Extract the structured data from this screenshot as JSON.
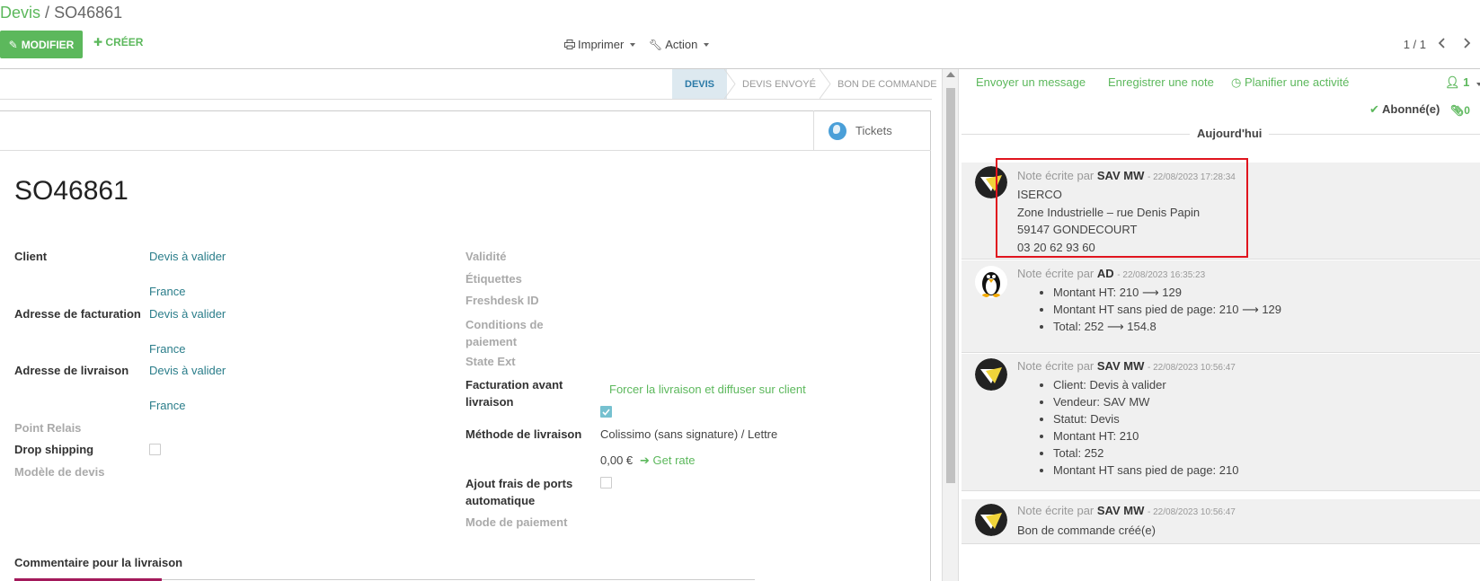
{
  "header": {
    "breadcrumb_parent": "Devis",
    "breadcrumb_sep": "/",
    "breadcrumb_current": "SO46861",
    "edit_button": "MODIFIER",
    "create_button": "CRÉER",
    "print_menu": "Imprimer",
    "action_menu": "Action",
    "pager": "1 / 1"
  },
  "statusbar": {
    "stages": [
      "DEVIS",
      "DEVIS ENVOYÉ",
      "BON DE COMMANDE"
    ],
    "active": "DEVIS"
  },
  "sheet": {
    "tickets_button": "Tickets",
    "order_name": "SO46861",
    "left": {
      "client_label": "Client",
      "client_value": "Devis à valider",
      "client_country": "France",
      "invoice_label": "Adresse de facturation",
      "invoice_value": "Devis à valider",
      "invoice_country": "France",
      "delivery_label": "Adresse de livraison",
      "delivery_value": "Devis à valider",
      "delivery_country": "France",
      "relay_label": "Point Relais",
      "dropship_label": "Drop shipping",
      "template_label": "Modèle de devis",
      "comment_label": "Commentaire pour la livraison"
    },
    "right": {
      "validity_label": "Validité",
      "tags_label": "Étiquettes",
      "freshdesk_label": "Freshdesk ID",
      "payment_terms_label": "Conditions de paiement",
      "state_ext_label": "State Ext",
      "invoice_before_label": "Facturation avant livraison",
      "force_delivery_button": "Forcer la livraison et diffuser sur client",
      "delivery_method_label": "Méthode de livraison",
      "delivery_method_value": "Colissimo (sans signature) / Lettre",
      "shipping_cost": "0,00 €",
      "get_rate_button": "Get rate",
      "auto_shipping_label": "Ajout frais de ports automatique",
      "payment_mode_label": "Mode de paiement"
    }
  },
  "chatter": {
    "send_message": "Envoyer un message",
    "log_note": "Enregistrer une note",
    "schedule_activity": "Planifier une activité",
    "followers_count": "1",
    "subscribed": "Abonné(e)",
    "attachments_count": "0",
    "today": "Aujourd'hui",
    "messages": [
      {
        "prefix": "Note écrite par",
        "author": "SAV MW",
        "date": "- 22/08/2023 17:28:34",
        "lines": [
          "ISERCO",
          "Zone Industrielle – rue Denis Papin",
          "59147 GONDECOURT",
          "03 20 62 93 60"
        ]
      },
      {
        "prefix": "Note écrite par",
        "author": "AD",
        "date": "- 22/08/2023 16:35:23",
        "bullets": [
          "Montant HT: 210 ⟶ 129",
          "Montant HT sans pied de page: 210 ⟶ 129",
          "Total: 252 ⟶ 154.8"
        ]
      },
      {
        "prefix": "Note écrite par",
        "author": "SAV MW",
        "date": "- 22/08/2023 10:56:47",
        "bullets": [
          "Client: Devis à valider",
          "Vendeur: SAV MW",
          "Statut: Devis",
          "Montant HT: 210",
          "Total: 252",
          "Montant HT sans pied de page: 210"
        ]
      },
      {
        "prefix": "Note écrite par",
        "author": "SAV MW",
        "date": "- 22/08/2023 10:56:47",
        "lines": [
          "Bon de commande créé(e)"
        ]
      }
    ]
  },
  "colors": {
    "accent": "#5cb85c",
    "link": "#2a7d8a",
    "highlight": "#e0141e"
  }
}
